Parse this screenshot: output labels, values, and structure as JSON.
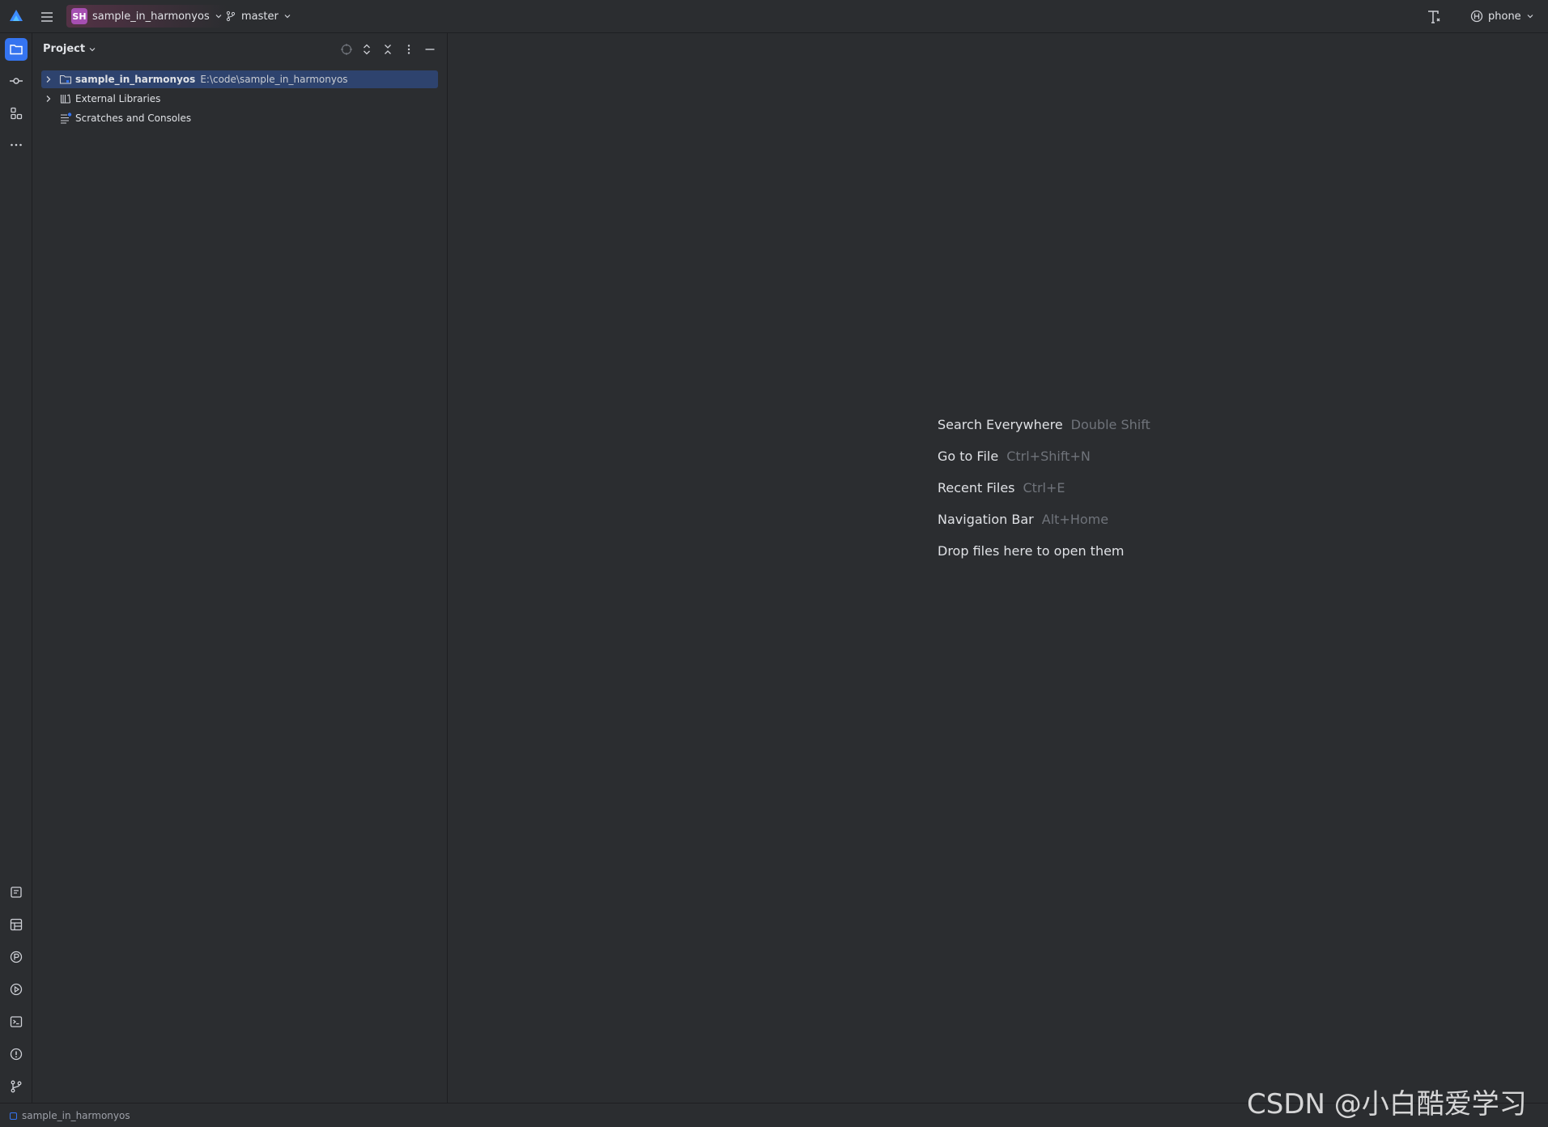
{
  "titlebar": {
    "project_badge": "SH",
    "project_name": "sample_in_harmonyos",
    "branch": "master",
    "device": "phone"
  },
  "project_panel": {
    "title": "Project",
    "tree": [
      {
        "name": "sample_in_harmonyos",
        "path": "E:\\code\\sample_in_harmonyos",
        "selected": true
      },
      {
        "name": "External Libraries"
      },
      {
        "name": "Scratches and Consoles"
      }
    ]
  },
  "editor": {
    "hints": [
      {
        "label": "Search Everywhere",
        "key": "Double Shift"
      },
      {
        "label": "Go to File",
        "key": "Ctrl+Shift+N"
      },
      {
        "label": "Recent Files",
        "key": "Ctrl+E"
      },
      {
        "label": "Navigation Bar",
        "key": "Alt+Home"
      },
      {
        "label": "Drop files here to open them",
        "key": ""
      }
    ]
  },
  "statusbar": {
    "project": "sample_in_harmonyos"
  },
  "watermark": "CSDN @小白酷爱学习",
  "colors": {
    "accent": "#3574f0",
    "selection": "#2e436e",
    "background": "#2b2d30",
    "project_badge": "#a64fb2"
  }
}
